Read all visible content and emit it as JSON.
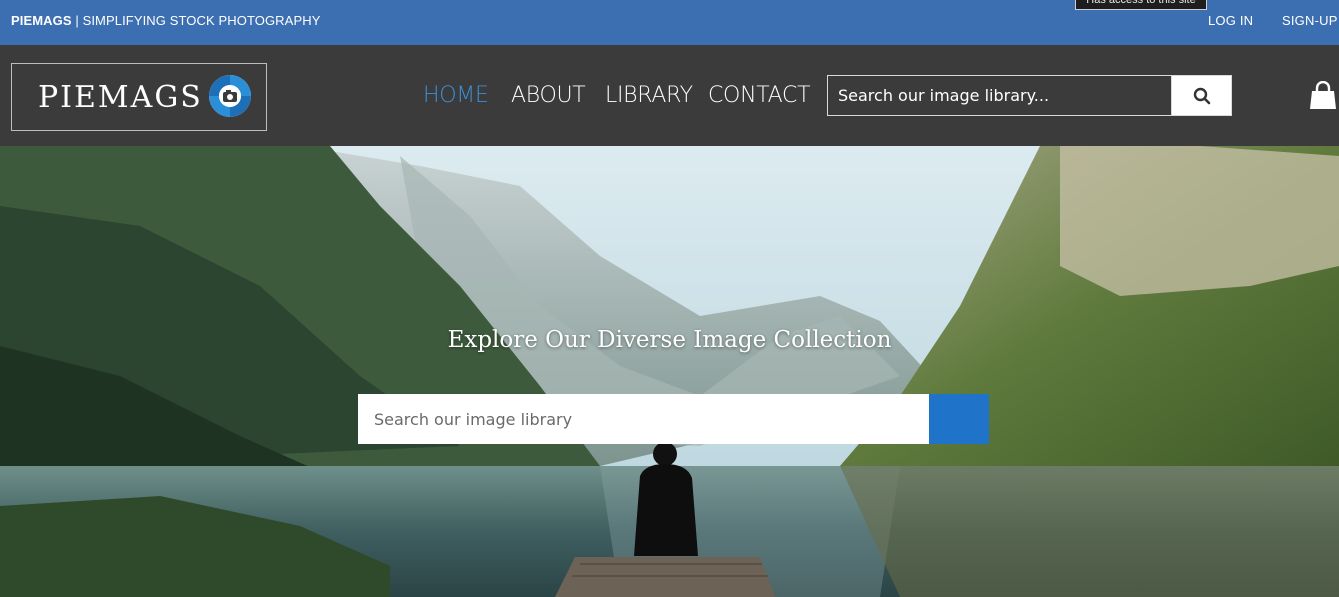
{
  "topbar": {
    "brand_bold": "PIEMAGS",
    "brand_sep": " | ",
    "brand_tagline": "SIMPLIFYING STOCK PHOTOGRAPHY",
    "tooltip": "Has access to this site",
    "login_label": "LOG IN",
    "signup_label": "SIGN-UP"
  },
  "header": {
    "logo_text": "PIEMAGS",
    "logo_icon": "camera-aperture-icon",
    "nav": {
      "home": "HOME",
      "about": "ABOUT",
      "library": "LIBRARY",
      "contact": "CONTACT"
    },
    "search_placeholder": "Search our image library...",
    "search_icon": "search-icon",
    "cart_icon": "shopping-bag-icon"
  },
  "hero": {
    "title": "Explore Our Diverse Image Collection",
    "search_placeholder": "Search our image library"
  },
  "colors": {
    "topbar_bg": "#3c6fb2",
    "header_bg": "#3b3b3b",
    "nav_active": "#3c8fd6",
    "hero_button": "#1f74c9"
  }
}
